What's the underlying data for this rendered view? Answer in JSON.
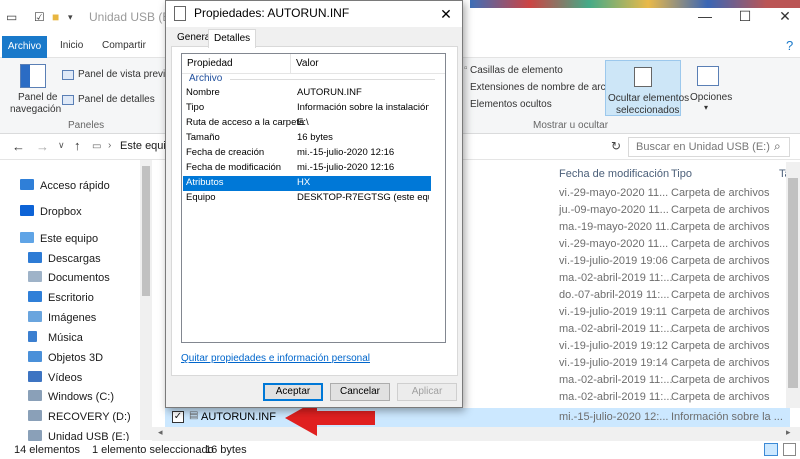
{
  "window": {
    "title": "Unidad USB (E:)",
    "minimize": "—",
    "maximize": "☐",
    "close": "✕"
  },
  "ribbon_tabs": [
    "Archivo",
    "Inicio",
    "Compartir"
  ],
  "ribbon": {
    "nav_pane_label_1": "Panel de",
    "nav_pane_label_2": "navegación",
    "preview_pane": "Panel de vista previa",
    "details_pane": "Panel de detalles",
    "group_panels": "Paneles",
    "item_checkboxes": "Casillas de elemento",
    "file_extensions": "Extensiones de nombre de archivo",
    "hidden_items": "Elementos ocultos",
    "hide_selected_1": "Ocultar elementos",
    "hide_selected_2": "seleccionados",
    "options": "Opciones",
    "group_show_hide": "Mostrar u ocultar"
  },
  "address": {
    "path": "Este equipo",
    "search_placeholder": "Buscar en Unidad USB (E:)"
  },
  "nav_items": [
    {
      "label": "Acceso rápido",
      "icon": "star-icon"
    },
    {
      "label": "Dropbox",
      "icon": "dropbox-icon"
    },
    {
      "label": "Este equipo",
      "icon": "computer-icon"
    },
    {
      "label": "Descargas",
      "icon": "download-icon"
    },
    {
      "label": "Documentos",
      "icon": "documents-icon"
    },
    {
      "label": "Escritorio",
      "icon": "desktop-icon"
    },
    {
      "label": "Imágenes",
      "icon": "pictures-icon"
    },
    {
      "label": "Música",
      "icon": "music-icon"
    },
    {
      "label": "Objetos 3D",
      "icon": "objects3d-icon"
    },
    {
      "label": "Vídeos",
      "icon": "videos-icon"
    },
    {
      "label": "Windows (C:)",
      "icon": "drive-icon"
    },
    {
      "label": "RECOVERY (D:)",
      "icon": "drive-icon"
    },
    {
      "label": "Unidad USB (E:)",
      "icon": "usb-drive-icon"
    }
  ],
  "list": {
    "col_date": "Fecha de modificación",
    "col_type": "Tipo",
    "col_size": "Ta",
    "rows": [
      {
        "date": "vi.-29-mayo-2020 11...",
        "type": "Carpeta de archivos"
      },
      {
        "date": "ju.-09-mayo-2020 11...",
        "type": "Carpeta de archivos"
      },
      {
        "date": "ma.-19-mayo-2020 11...",
        "type": "Carpeta de archivos"
      },
      {
        "date": "vi.-29-mayo-2020 11...",
        "type": "Carpeta de archivos"
      },
      {
        "date": "vi.-19-julio-2019 19:06",
        "type": "Carpeta de archivos"
      },
      {
        "date": "ma.-02-abril-2019 11:...",
        "type": "Carpeta de archivos"
      },
      {
        "date": "do.-07-abril-2019 11:...",
        "type": "Carpeta de archivos"
      },
      {
        "date": "vi.-19-julio-2019 19:11",
        "type": "Carpeta de archivos"
      },
      {
        "date": "ma.-02-abril-2019 11:...",
        "type": "Carpeta de archivos"
      },
      {
        "date": "vi.-19-julio-2019 19:12",
        "type": "Carpeta de archivos"
      },
      {
        "date": "vi.-19-julio-2019 19:14",
        "type": "Carpeta de archivos"
      },
      {
        "date": "ma.-02-abril-2019 11:...",
        "type": "Carpeta de archivos"
      },
      {
        "date": "ma.-02-abril-2019 11:...",
        "type": "Carpeta de archivos"
      }
    ],
    "selected": {
      "name": "AUTORUN.INF",
      "date": "mi.-15-julio-2020 12:...",
      "type": "Información sobre la ..."
    }
  },
  "status": {
    "count": "14 elementos",
    "selected": "1 elemento seleccionado",
    "size": "16 bytes"
  },
  "dialog": {
    "title": "Propiedades: AUTORUN.INF",
    "close": "✕",
    "tabs": [
      "General",
      "Detalles"
    ],
    "active_tab": "Detalles",
    "col_property": "Propiedad",
    "col_value": "Valor",
    "group": "Archivo",
    "props": [
      {
        "k": "Nombre",
        "v": "AUTORUN.INF"
      },
      {
        "k": "Tipo",
        "v": "Información sobre la instalación"
      },
      {
        "k": "Ruta de acceso a la carpeta",
        "v": "E:\\"
      },
      {
        "k": "Tamaño",
        "v": "16 bytes"
      },
      {
        "k": "Fecha de creación",
        "v": "mi.-15-julio-2020 12:16"
      },
      {
        "k": "Fecha de modificación",
        "v": "mi.-15-julio-2020 12:16"
      },
      {
        "k": "Atributos",
        "v": "HX"
      },
      {
        "k": "Equipo",
        "v": "DESKTOP-R7EGTSG (este equi..."
      }
    ],
    "selected_prop": "Atributos",
    "remove_link": "Quitar propiedades e información personal",
    "ok": "Aceptar",
    "cancel": "Cancelar",
    "apply": "Aplicar"
  },
  "colors": {
    "accent": "#0078d7",
    "ribbon_file_tab": "#1979ca",
    "selection": "#cce8ff",
    "arrow": "#e02020"
  }
}
